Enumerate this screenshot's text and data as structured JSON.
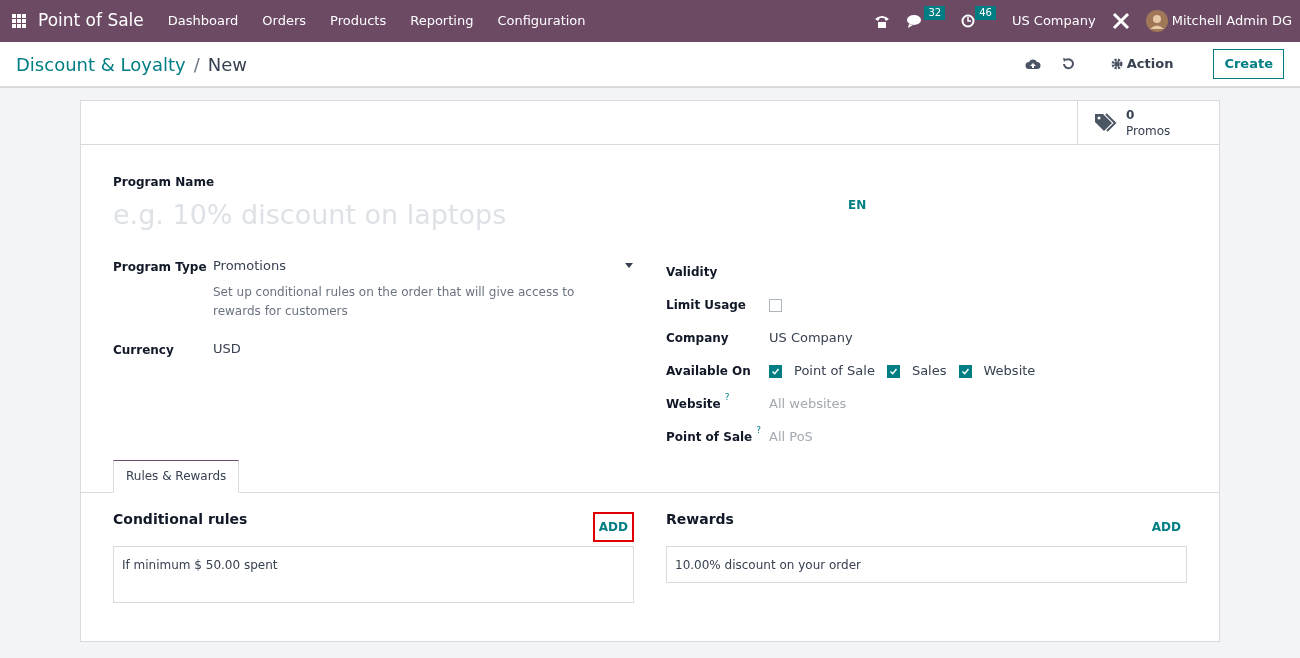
{
  "navbar": {
    "app_title": "Point of Sale",
    "menu": [
      "Dashboard",
      "Orders",
      "Products",
      "Reporting",
      "Configuration"
    ],
    "messages_count": "32",
    "activities_count": "46",
    "company": "US Company",
    "user": "Mitchell Admin DG"
  },
  "breadcrumb": {
    "parent": "Discount & Loyalty",
    "separator": "/",
    "current": "New"
  },
  "control_actions": {
    "action": "Action",
    "create": "Create"
  },
  "smart_button": {
    "value": "0",
    "label": "Promos"
  },
  "program_name": {
    "label": "Program Name",
    "placeholder": "e.g. 10% discount on laptops",
    "language": "EN"
  },
  "left_fields": [
    {
      "kind": "select",
      "label": "Program Type",
      "value": "Promotions",
      "help": "Set up conditional rules on the order that will give access to rewards for customers"
    },
    {
      "kind": "text",
      "label": "Currency",
      "value": "USD"
    }
  ],
  "right_fields": [
    {
      "kind": "empty",
      "label": "Validity"
    },
    {
      "kind": "checkbox",
      "label": "Limit Usage",
      "checked": false
    },
    {
      "kind": "text",
      "label": "Company",
      "value": "US Company"
    },
    {
      "kind": "checks",
      "label": "Available On",
      "options": [
        {
          "label": "Point of Sale",
          "checked": true
        },
        {
          "label": "Sales",
          "checked": true
        },
        {
          "label": "Website",
          "checked": true
        }
      ]
    },
    {
      "kind": "placeholder",
      "label": "Website",
      "tooltip": "?",
      "placeholder": "All websites"
    },
    {
      "kind": "placeholder",
      "label": "Point of Sale",
      "tooltip": "?",
      "placeholder": "All PoS"
    }
  ],
  "tabs": [
    {
      "label": "Rules & Rewards",
      "selected": true
    }
  ],
  "sections": [
    {
      "title": "Conditional rules",
      "add": "ADD",
      "highlighted": true,
      "items": [
        "If minimum $ 50.00 spent"
      ]
    },
    {
      "title": "Rewards",
      "add": "ADD",
      "highlighted": false,
      "items": [
        "10.00% discount on your order"
      ]
    }
  ]
}
